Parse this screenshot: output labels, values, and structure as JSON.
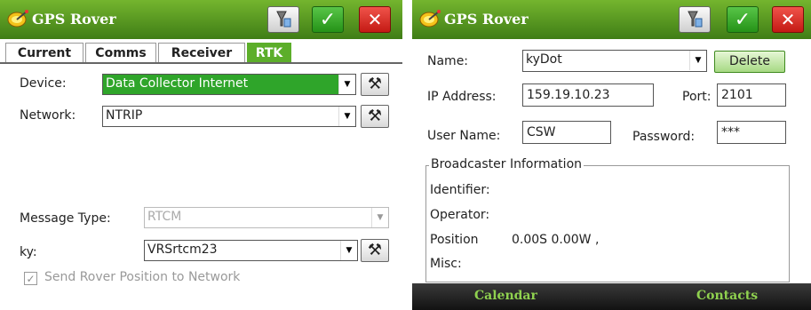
{
  "left": {
    "window_title": "GPS Rover",
    "tabs": [
      {
        "label": "Current",
        "active": false
      },
      {
        "label": "Comms",
        "active": false
      },
      {
        "label": "Receiver",
        "active": false
      },
      {
        "label": "RTK",
        "active": true
      }
    ],
    "device": {
      "label": "Device:",
      "value": "Data Collector Internet"
    },
    "network": {
      "label": "Network:",
      "value": "NTRIP"
    },
    "message_type": {
      "label": "Message Type:",
      "value": "RTCM",
      "disabled": true
    },
    "ky": {
      "label": "ky:",
      "value": "VRSrtcm23"
    },
    "send_position": {
      "label": "Send Rover Position to Network",
      "checked": true,
      "disabled": true
    }
  },
  "right": {
    "window_title": "GPS Rover",
    "name": {
      "label": "Name:",
      "value": "kyDot"
    },
    "delete_label": "Delete",
    "ip": {
      "label": "IP Address:",
      "value": "159.19.10.23"
    },
    "port": {
      "label": "Port:",
      "value": "2101"
    },
    "user": {
      "label": "User Name:",
      "value": "CSW"
    },
    "password": {
      "label": "Password:",
      "value": "***"
    },
    "broadcaster": {
      "legend": "Broadcaster Information",
      "identifier_label": "Identifier:",
      "operator_label": "Operator:",
      "position_label": "Position",
      "position_value": "0.00S 0.00W ,",
      "misc_label": "Misc:"
    },
    "softkeys": {
      "left": "Calendar",
      "right": "Contacts"
    }
  },
  "colors": {
    "titlebar": "#4f9a1e",
    "accent": "#2fa52a",
    "ok_button": "#2f9b1f",
    "close_button": "#d2231c"
  },
  "icons": {
    "app": "satellite-dish-icon",
    "device": "device-icon",
    "ok": "checkmark-icon",
    "close": "close-icon",
    "tool": "tools-icon"
  }
}
